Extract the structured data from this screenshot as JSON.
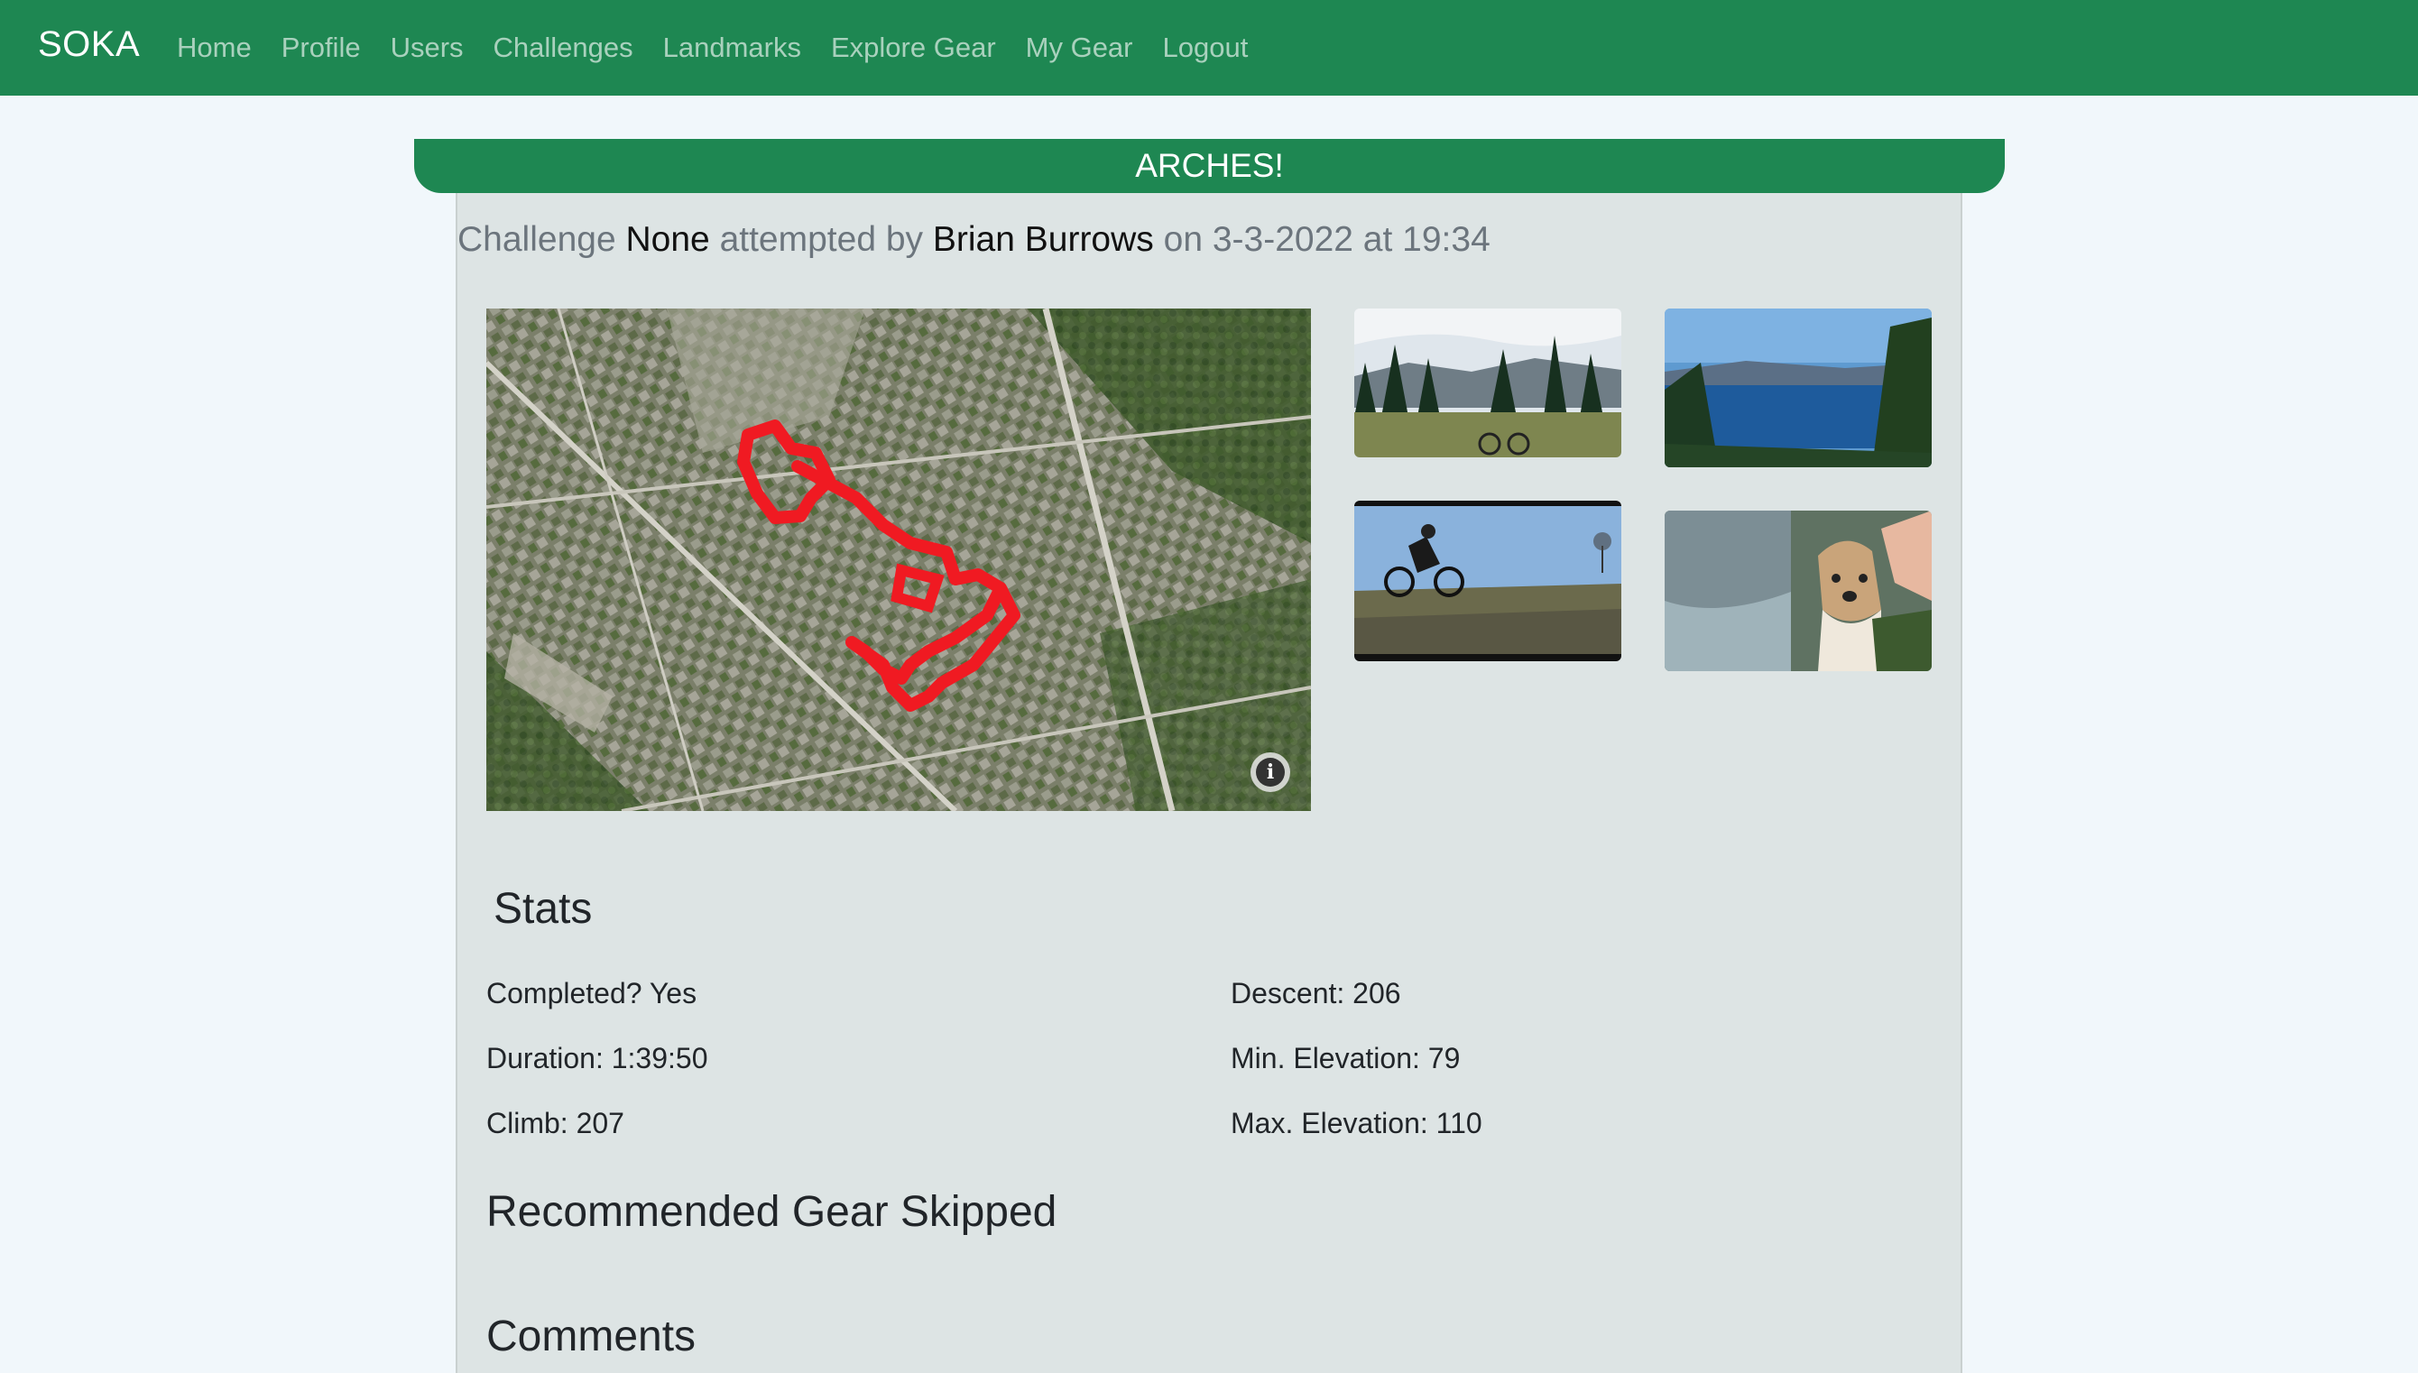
{
  "nav": {
    "brand": "SOKA",
    "links": [
      "Home",
      "Profile",
      "Users",
      "Challenges",
      "Landmarks",
      "Explore Gear",
      "My Gear",
      "Logout"
    ]
  },
  "banner": {
    "title": "ARCHES!"
  },
  "attempt": {
    "prefix": "Challenge",
    "challenge_name": "None",
    "middle": "attempted by",
    "user": "Brian Burrows",
    "date_text": "on 3-3-2022 at 19:34"
  },
  "map": {
    "info_icon": "info-icon",
    "route_color": "#f01a22"
  },
  "photos": [
    {
      "name": "photo-bike-forest",
      "alt": "bike-forest-photo"
    },
    {
      "name": "photo-lake",
      "alt": "lake-photo"
    },
    {
      "name": "photo-rider",
      "alt": "mountain-biker-photo"
    },
    {
      "name": "photo-dog",
      "alt": "dog-photo"
    }
  ],
  "stats": {
    "heading": "Stats",
    "completed": "Completed? Yes",
    "duration": "Duration: 1:39:50",
    "climb": "Climb: 207",
    "descent": "Descent: 206",
    "min_elevation": "Min. Elevation: 79",
    "max_elevation": "Max. Elevation: 110"
  },
  "sections": {
    "gear_skipped": "Recommended Gear Skipped",
    "comments": "Comments"
  },
  "colors": {
    "primary": "#1e8752",
    "page_bg": "#f1f7fb",
    "card_bg": "#dde4e4",
    "muted_text": "#6c757d"
  }
}
